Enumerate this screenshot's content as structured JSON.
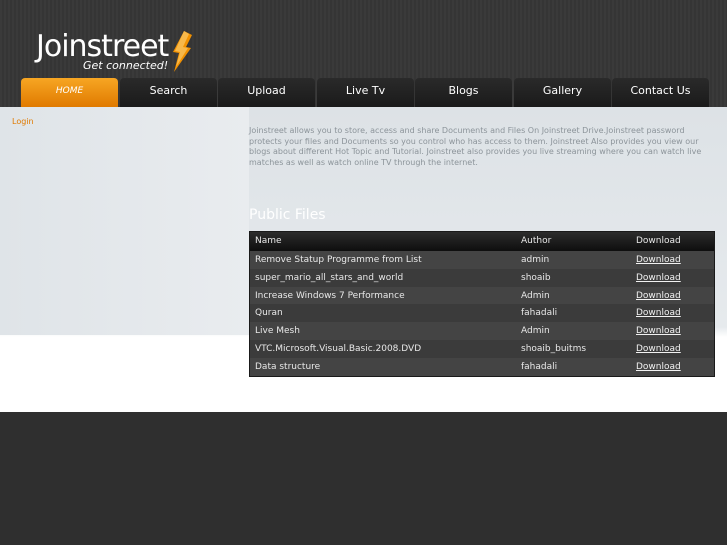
{
  "logo": {
    "name": "Joinstreet",
    "tagline": "Get connected!"
  },
  "nav": {
    "items": [
      {
        "label": "HOME",
        "active": true
      },
      {
        "label": "Search"
      },
      {
        "label": "Upload"
      },
      {
        "label": "Live Tv"
      },
      {
        "label": "Blogs"
      },
      {
        "label": "Gallery"
      },
      {
        "label": "Contact Us"
      }
    ]
  },
  "sidebar": {
    "login_label": "Login"
  },
  "intro": "Joinstreet allows you to store, access and share Documents and Files On Joinstreet Drive.Joinstreet password protects your files and Documents so you control who has access to them. Joinstreet Also provides you view our blogs about different Hot Topic and Tutorial. Joinstreet also provides you live streaming where you can watch live matches as well as watch online TV through the internet.",
  "files": {
    "title": "Public Files",
    "columns": [
      "Name",
      "Author",
      "Download"
    ],
    "rows": [
      {
        "name": "Remove Statup Programme from List",
        "author": "admin",
        "download": "Download"
      },
      {
        "name": "super_mario_all_stars_and_world",
        "author": "shoaib",
        "download": "Download"
      },
      {
        "name": "Increase Windows 7 Performance",
        "author": "Admin",
        "download": "Download"
      },
      {
        "name": "Quran",
        "author": "fahadali",
        "download": "Download"
      },
      {
        "name": "Live Mesh",
        "author": "Admin",
        "download": "Download"
      },
      {
        "name": "VTC.Microsoft.Visual.Basic.2008.DVD",
        "author": "shoaib_buitms",
        "download": "Download"
      },
      {
        "name": "Data structure",
        "author": "fahadali",
        "download": "Download"
      }
    ]
  },
  "colors": {
    "accent": "#f29100",
    "header_bg": "#383838",
    "content_bg": "#e3e7ea",
    "table_bg": "#3b3b3b"
  }
}
